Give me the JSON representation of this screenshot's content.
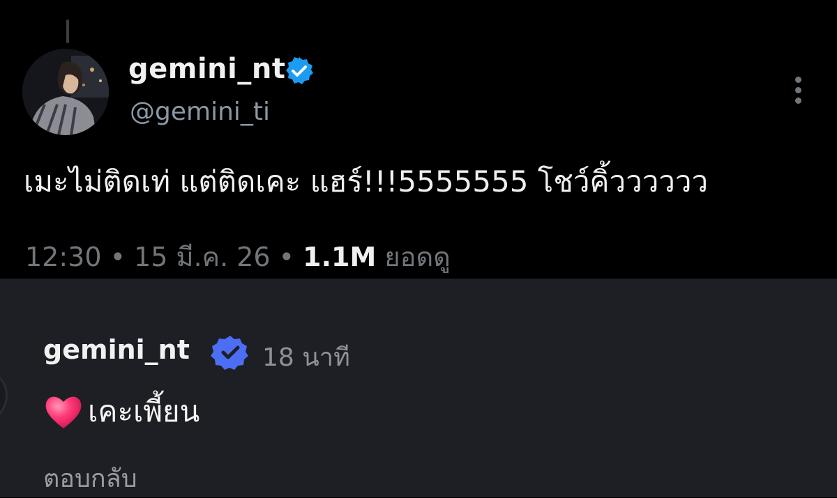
{
  "tweet": {
    "display_name": "gemini_nt",
    "handle": "@gemini_ti",
    "text": "เมะไม่ติดเท่ แต่ติดเคะ แฮร์!!!5555555 โชว์คิ้วววววว",
    "time": "12:30",
    "separator": " • ",
    "date": "15 มี.ค. 26",
    "views_count": "1.1M",
    "views_label": " ยอดดู",
    "verified_color": "#1d9bf0"
  },
  "reply": {
    "username": "gemini_nt",
    "time_ago": "18 นาที",
    "text": "เคะเพี้ยน",
    "reply_label": "ตอบกลับ",
    "verified_color": "#4c6ef5"
  }
}
